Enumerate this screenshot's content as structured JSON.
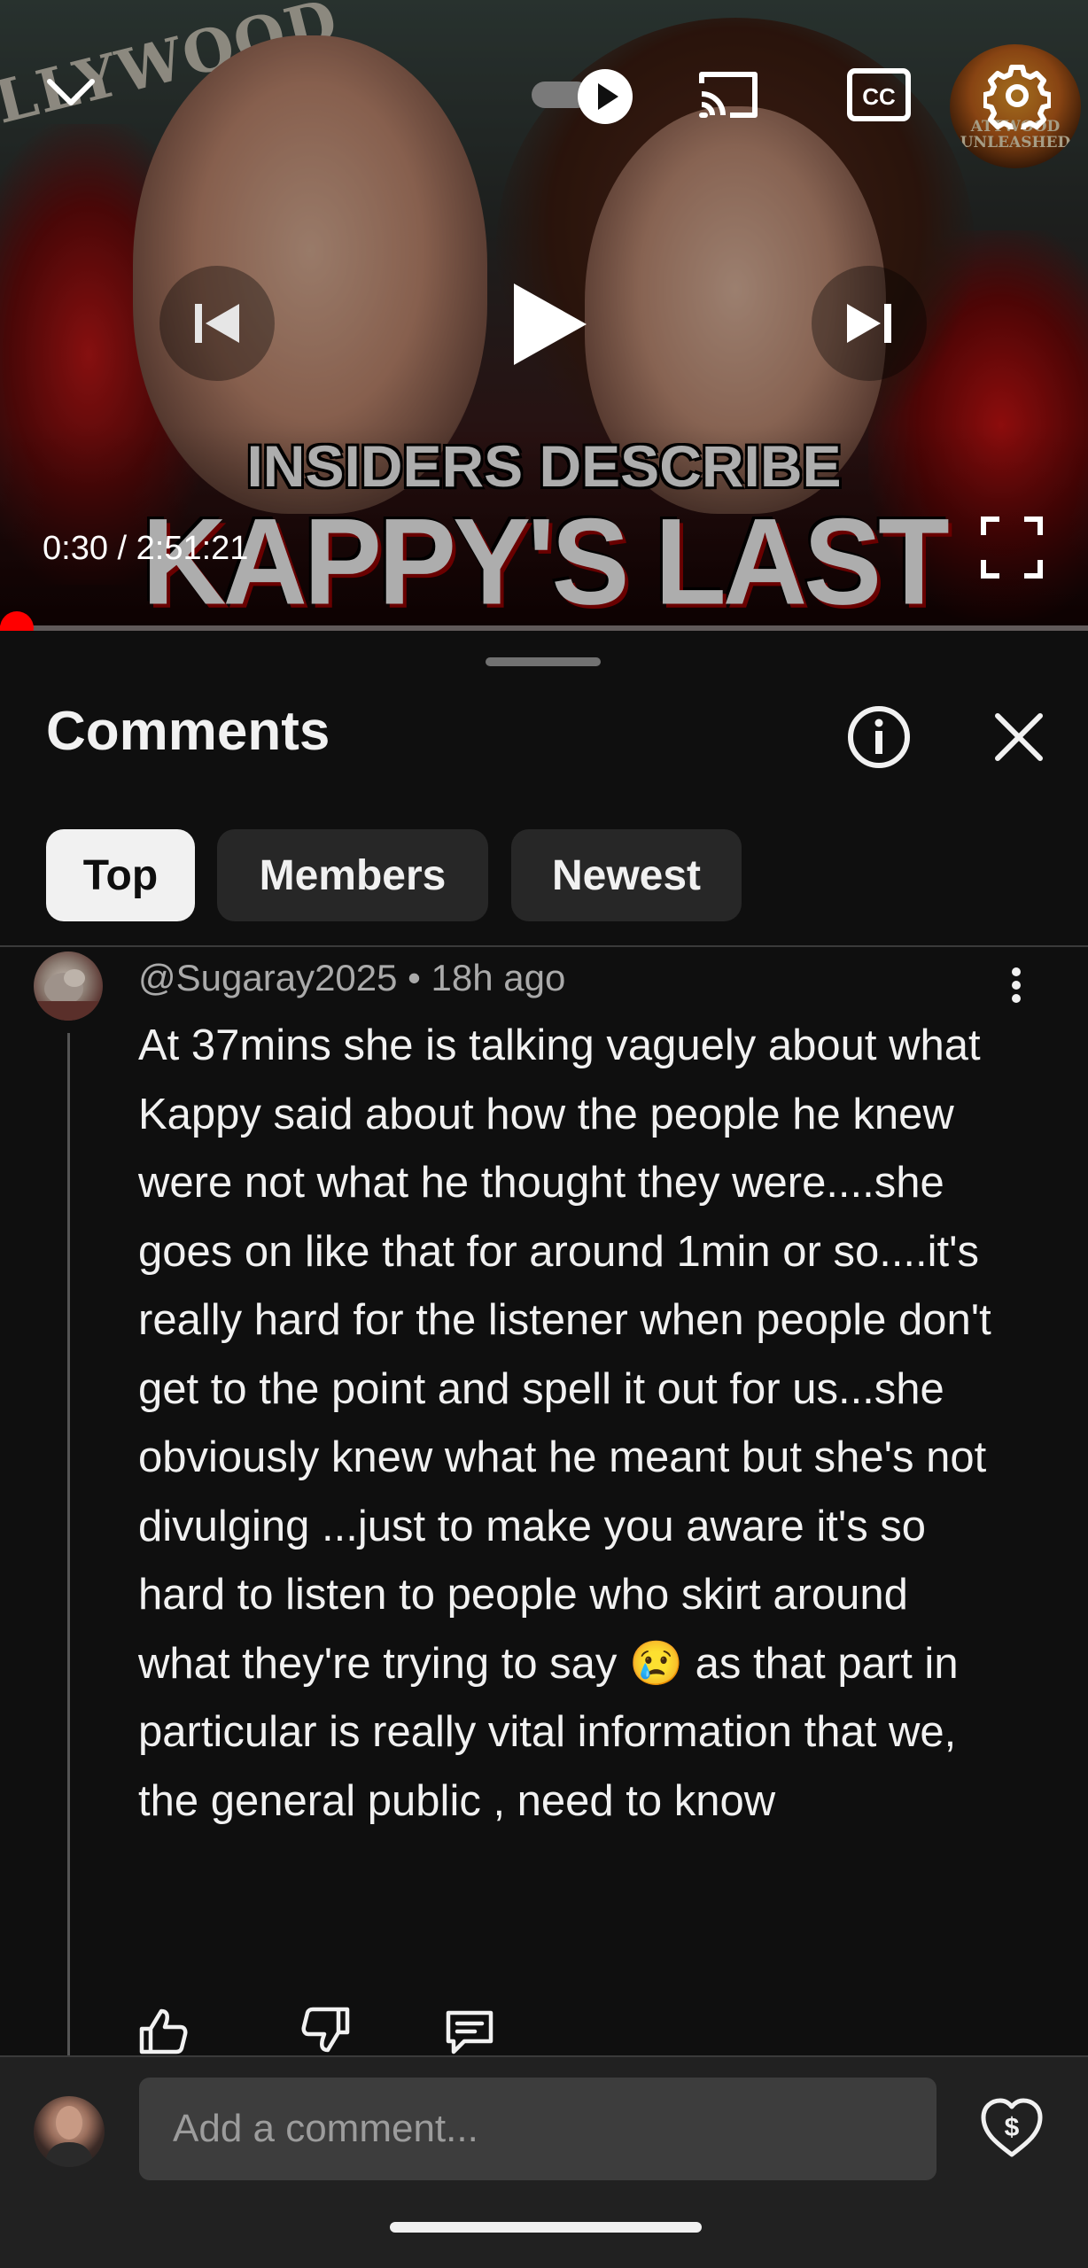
{
  "video": {
    "headline_top": "INSIDERS DESCRIBE",
    "headline_bottom": "KAPPY'S LAST DAYS!",
    "sign_text": "LLYWOOD",
    "channel_badge": "ATTWOOD UNLEASHED",
    "current_time": "0:30",
    "duration": "2:51:21",
    "time_display": "0:30 / 2:51:21",
    "progress_fraction": 0.0029,
    "autoplay_on": true,
    "accent_color": "#ff0000"
  },
  "comments_panel": {
    "title": "Comments",
    "tabs": [
      {
        "label": "Top",
        "active": true
      },
      {
        "label": "Members",
        "active": false
      },
      {
        "label": "Newest",
        "active": false
      }
    ]
  },
  "comment": {
    "author": "@Sugaray2025",
    "age": "18h ago",
    "meta": "@Sugaray2025 • 18h ago",
    "text": "At 37mins she is talking vaguely about what Kappy said about how the people he knew were not what he thought they were....she goes on like that for around 1min or so....it's really hard for the listener when people don't get to the point and spell it out for us...she obviously knew what he meant but she's not divulging ...just to make you aware it's so hard to listen to people who skirt around what they're trying to say 😢 as that part in particular is really vital information that we, the general public , need to know"
  },
  "composer": {
    "placeholder": "Add a comment..."
  },
  "icons": {
    "collapse": "chevron-down-icon",
    "autoplay": "autoplay-toggle-icon",
    "cast": "cast-icon",
    "captions": "cc-icon",
    "settings": "gear-icon",
    "previous": "skip-previous-icon",
    "play": "play-icon",
    "next": "skip-next-icon",
    "fullscreen": "fullscreen-icon",
    "info": "info-icon",
    "close": "close-icon",
    "more": "more-vertical-icon",
    "like": "thumbs-up-icon",
    "dislike": "thumbs-down-icon",
    "reply": "reply-icon",
    "super_thanks": "super-thanks-icon"
  }
}
